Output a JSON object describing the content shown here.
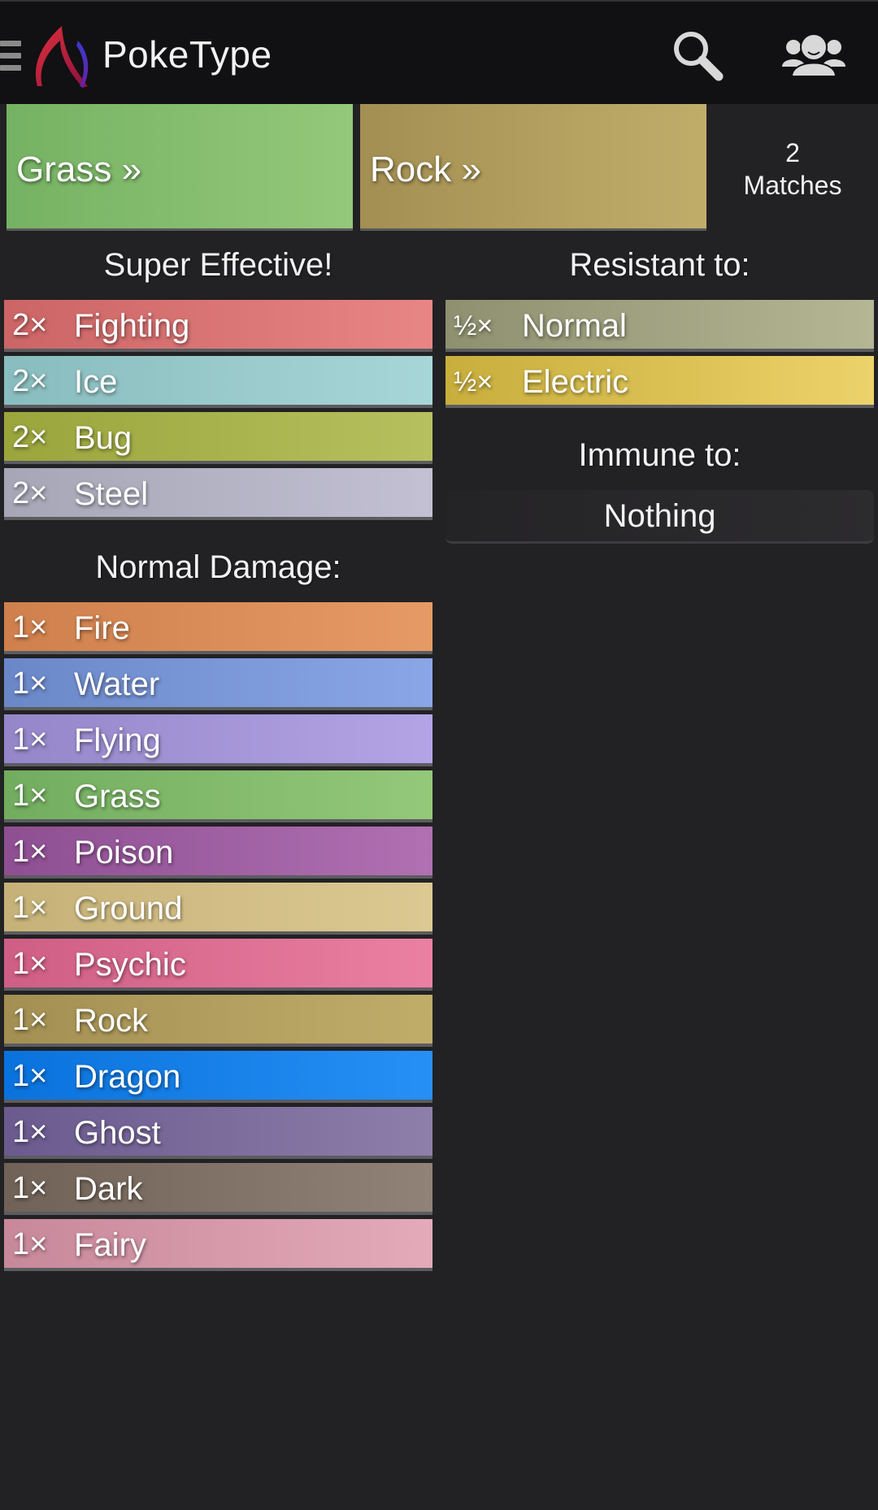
{
  "app": {
    "title": "PokeType",
    "icons": {
      "menu": "hamburger-menu-icon",
      "logo": "poketype-logo",
      "search": "search-icon",
      "people": "people-group-icon"
    }
  },
  "selected_types": [
    {
      "label": "Grass »",
      "color": "#85bd6e"
    },
    {
      "label": "Rock »",
      "color": "#b19e5e"
    }
  ],
  "matches": {
    "count": "2",
    "label": "Matches"
  },
  "super_effective": {
    "title": "Super Effective!",
    "items": [
      {
        "mult": "2×",
        "type": "Fighting",
        "from": "#cc6565",
        "to": "#e88585"
      },
      {
        "mult": "2×",
        "type": "Ice",
        "from": "#88bcbe",
        "to": "#a8d6d8"
      },
      {
        "mult": "2×",
        "type": "Bug",
        "from": "#9aa53c",
        "to": "#b6c05e"
      },
      {
        "mult": "2×",
        "type": "Steel",
        "from": "#a6a6b6",
        "to": "#c2c0d2"
      }
    ]
  },
  "normal_damage": {
    "title": "Normal Damage:",
    "items": [
      {
        "mult": "1×",
        "type": "Fire",
        "from": "#cf804c",
        "to": "#e69a66"
      },
      {
        "mult": "1×",
        "type": "Water",
        "from": "#6a88c8",
        "to": "#8aa6e6"
      },
      {
        "mult": "1×",
        "type": "Flying",
        "from": "#9486c8",
        "to": "#b4a4e6"
      },
      {
        "mult": "1×",
        "type": "Grass",
        "from": "#72ad5f",
        "to": "#94c87a"
      },
      {
        "mult": "1×",
        "type": "Poison",
        "from": "#8e4f92",
        "to": "#b070b2"
      },
      {
        "mult": "1×",
        "type": "Ground",
        "from": "#c6b278",
        "to": "#dcc892"
      },
      {
        "mult": "1×",
        "type": "Psychic",
        "from": "#cf5e84",
        "to": "#ea80a2"
      },
      {
        "mult": "1×",
        "type": "Rock",
        "from": "#a38f52",
        "to": "#c1ad6a"
      },
      {
        "mult": "1×",
        "type": "Dragon",
        "from": "#0a72dc",
        "to": "#2690f6"
      },
      {
        "mult": "1×",
        "type": "Ghost",
        "from": "#6a5a8e",
        "to": "#8e7eaa"
      },
      {
        "mult": "1×",
        "type": "Dark",
        "from": "#706256",
        "to": "#908276"
      },
      {
        "mult": "1×",
        "type": "Fairy",
        "from": "#c7889a",
        "to": "#e4aaba"
      }
    ]
  },
  "resistant": {
    "title": "Resistant to:",
    "items": [
      {
        "mult": "½×",
        "type": "Normal",
        "from": "#8e9070",
        "to": "#b4b694"
      },
      {
        "mult": "½×",
        "type": "Electric",
        "from": "#c8ae3c",
        "to": "#ecd26a"
      }
    ]
  },
  "immune": {
    "title": "Immune to:",
    "value": "Nothing"
  }
}
